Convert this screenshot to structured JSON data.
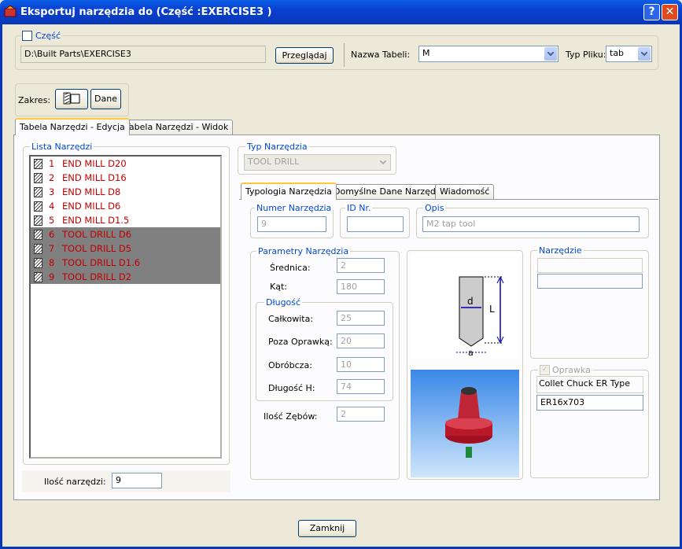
{
  "window": {
    "title": "Eksportuj narzędzia do  (Część :EXERCISE3 )",
    "help_label": "?",
    "close_label": "✕"
  },
  "top": {
    "part_checkbox_label": "Część",
    "path": "D:\\Built Parts\\EXERCISE3",
    "browse_label": "Przeglądaj",
    "table_name_label": "Nazwa Tabeli:",
    "table_name_value": "M",
    "file_type_label": "Typ Pliku:",
    "file_type_value": "tab"
  },
  "range": {
    "label": "Zakres:",
    "data_label": "Dane"
  },
  "tabs": [
    "Tabela Narzędzi - Edycja",
    "Tabela Narzędzi - Widok"
  ],
  "tool_list": {
    "legend": "Lista  Narzędzi",
    "items": [
      {
        "num": "1",
        "name": "END MILL  D20"
      },
      {
        "num": "2",
        "name": "END MILL  D16"
      },
      {
        "num": "3",
        "name": "END MILL  D8"
      },
      {
        "num": "4",
        "name": "END MILL  D6"
      },
      {
        "num": "5",
        "name": "END MILL  D1.5"
      },
      {
        "num": "6",
        "name": "TOOL DRILL  D6"
      },
      {
        "num": "7",
        "name": "TOOL DRILL  D5"
      },
      {
        "num": "8",
        "name": "TOOL DRILL  D1.6"
      },
      {
        "num": "9",
        "name": "TOOL DRILL  D2"
      }
    ],
    "count_label": "Ilość narzędzi:",
    "count_value": "9"
  },
  "tool_type": {
    "legend": "Typ Narzędzia",
    "value": "TOOL DRILL"
  },
  "subtabs": [
    "Typologia Narzędzia",
    "Domyślne Dane Narzędzia",
    "Wiadomość"
  ],
  "typology": {
    "number_legend": "Numer Narzędzia",
    "number_value": "9",
    "id_legend": "ID Nr.",
    "id_value": "",
    "desc_legend": "Opis",
    "desc_value": "M2 tap tool",
    "params_legend": "Parametry Narzędzia",
    "diameter_label": "Średnica:",
    "diameter_value": "2",
    "angle_label": "Kąt:",
    "angle_value": "180",
    "length_legend": "Długość",
    "total_label": "Całkowita:",
    "total_value": "25",
    "outside_label": "Poza Oprawką:",
    "outside_value": "20",
    "machining_label": "Obróbcza:",
    "machining_value": "10",
    "lengthh_label": "Długość H:",
    "lengthh_value": "74",
    "teeth_label": "Ilość Zębów:",
    "teeth_value": "2",
    "tool_legend": "Narzędzie",
    "holder_legend": "Oprawka",
    "holder_type": "Collet Chuck ER Type",
    "holder_value": "ER16x703",
    "diagram_d": "d",
    "diagram_l": "L",
    "diagram_a": "a"
  },
  "footer": {
    "close_label": "Zamknij"
  }
}
